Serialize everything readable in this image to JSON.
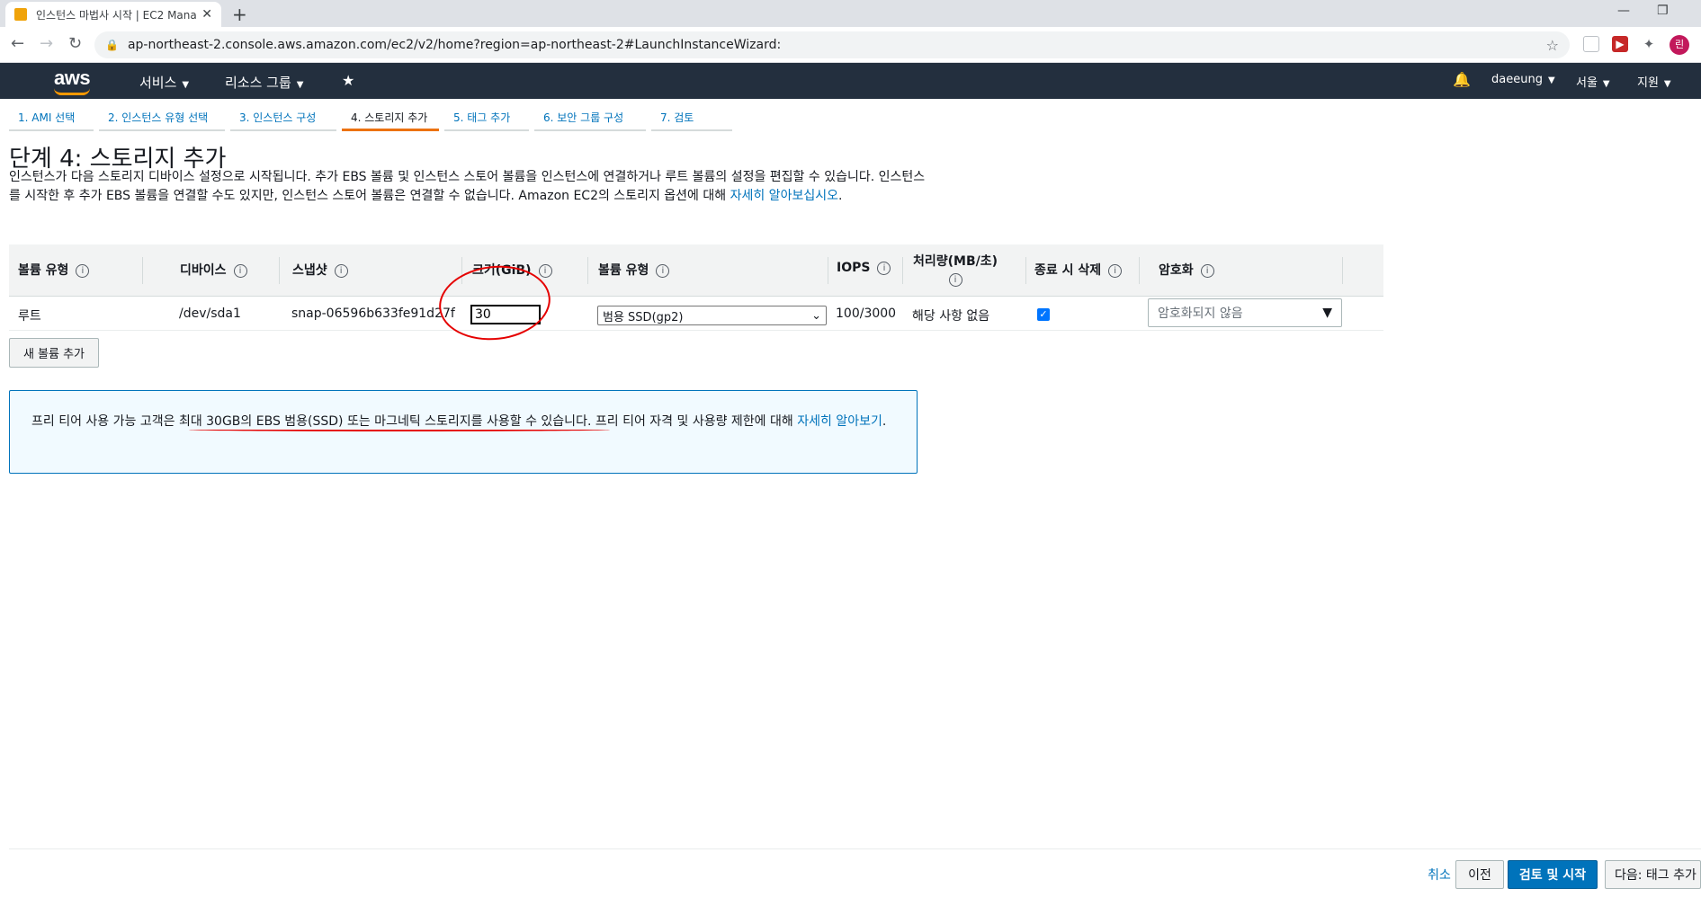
{
  "browser": {
    "tab_title": "인스턴스 마법사 시작 | EC2 Mana",
    "tab_close": "✕",
    "new_tab": "+",
    "url": "ap-northeast-2.console.aws.amazon.com/ec2/v2/home?region=ap-northeast-2#LaunchInstanceWizard:",
    "profile_initial": "린",
    "minimize": "—",
    "restore": "❐"
  },
  "aws_nav": {
    "logo": "aws",
    "services": "서비스",
    "resource_groups": "리소스 그룹",
    "user": "daeeung",
    "region": "서울",
    "support": "지원"
  },
  "wizard_tabs": [
    {
      "label": "1. AMI 선택"
    },
    {
      "label": "2. 인스턴스 유형 선택"
    },
    {
      "label": "3. 인스턴스 구성"
    },
    {
      "label": "4. 스토리지 추가"
    },
    {
      "label": "5. 태그 추가"
    },
    {
      "label": "6. 보안 그룹 구성"
    },
    {
      "label": "7. 검토"
    }
  ],
  "page": {
    "heading": "단계 4: 스토리지 추가",
    "description": "인스턴스가 다음 스토리지 디바이스 설정으로 시작됩니다. 추가 EBS 볼륨 및 인스턴스 스토어 볼륨을 인스턴스에 연결하거나 루트 볼륨의 설정을 편집할 수 있습니다. 인스턴스를 시작한 후 추가 EBS 볼륨을 연결할 수도 있지만, 인스턴스 스토어 볼륨은 연결할 수 없습니다. Amazon EC2의 스토리지 옵션에 대해 ",
    "description_link": "자세히 알아보십시오",
    "description_end": "."
  },
  "table": {
    "headers": {
      "volume_type": "볼륨 유형",
      "device": "디바이스",
      "snapshot": "스냅샷",
      "size": "크기(GiB)",
      "ebs_type": "볼륨 유형",
      "iops": "IOPS",
      "throughput": "처리량(MB/초)",
      "delete_on_term": "종료 시 삭제",
      "encryption": "암호화"
    },
    "info_glyph": "i",
    "row": {
      "volume_type": "루트",
      "device": "/dev/sda1",
      "snapshot": "snap-06596b633fe91d27f",
      "size": "30",
      "ebs_type": "범용 SSD(gp2)",
      "iops": "100/3000",
      "throughput": "해당 사항 없음",
      "delete_on_term_checked": true,
      "encryption": "암호화되지 않음"
    }
  },
  "add_volume_button": "새 볼륨 추가",
  "alert": {
    "prefix": "프리 티어 사용 가능 고객은 ",
    "highlight": "최대 30GB의 EBS 범용(SSD) 또는 마그네틱 스토리지를 사용할 수 있습니다",
    "middle": ". 프리 티어 자격 및 사용량 제한에 대해 ",
    "link": "자세히 알아보기",
    "end": "."
  },
  "footer": {
    "cancel": "취소",
    "previous": "이전",
    "review_launch": "검토 및 시작",
    "next": "다음: 태그 추가"
  },
  "colors": {
    "aws_nav_bg": "#232f3e",
    "aws_orange": "#ff9900",
    "link_blue": "#0073bb",
    "annotation_red": "#e50000"
  }
}
